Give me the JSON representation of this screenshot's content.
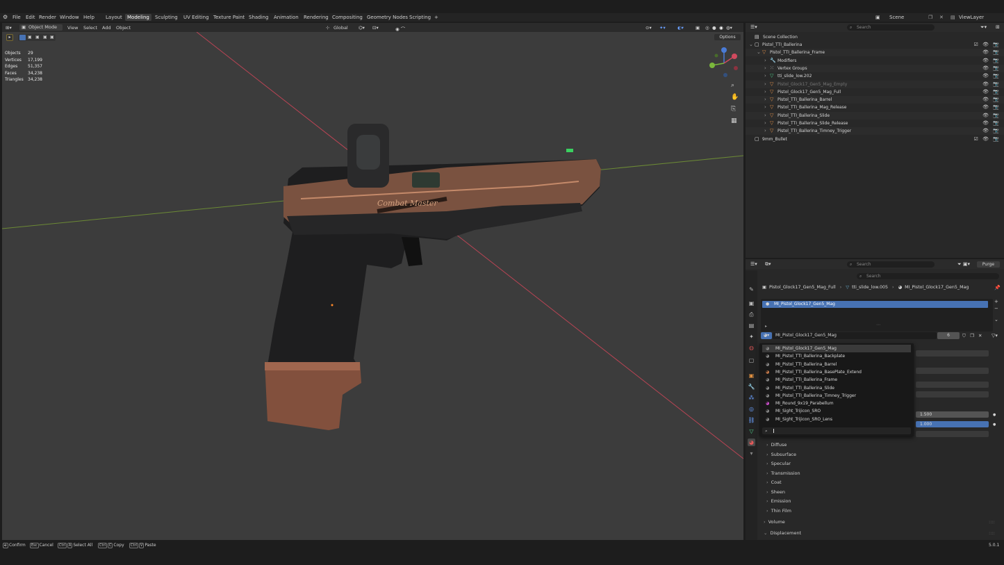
{
  "menus": [
    "File",
    "Edit",
    "Render",
    "Window",
    "Help"
  ],
  "workspaces": [
    "Layout",
    "Modeling",
    "Sculpting",
    "UV Editing",
    "Texture Paint",
    "Shading",
    "Animation",
    "Rendering",
    "Compositing",
    "Geometry Nodes",
    "Scripting"
  ],
  "scene_label": "Scene",
  "viewlayer_label": "ViewLayer",
  "viewport_header": {
    "mode": "Object Mode",
    "menus": [
      "View",
      "Select",
      "Add",
      "Object"
    ],
    "orientation": "Global",
    "options": "Options"
  },
  "stats": [
    {
      "label": "Objects",
      "value": "29"
    },
    {
      "label": "Vertices",
      "value": "17,199"
    },
    {
      "label": "Edges",
      "value": "51,357"
    },
    {
      "label": "Faces",
      "value": "34,238"
    },
    {
      "label": "Triangles",
      "value": "34,238"
    }
  ],
  "gun_text": "Combat Master",
  "outliner": {
    "search_placeholder": "Search",
    "root": "Scene Collection",
    "rows": [
      {
        "label": "Pistol_TTI_Ballerina",
        "indent": 0
      },
      {
        "label": "Pistol_TTI_Ballerina_Frame",
        "indent": 1
      },
      {
        "label": "Modifiers",
        "indent": 2
      },
      {
        "label": "Vertex Groups",
        "indent": 2
      },
      {
        "label": "tti_slide_low.202",
        "indent": 2
      },
      {
        "label": "Pistol_Glock17_Gen5_Mag_Empty",
        "indent": 2,
        "dim": true
      },
      {
        "label": "Pistol_Glock17_Gen5_Mag_Full",
        "indent": 2
      },
      {
        "label": "Pistol_TTI_Ballerina_Barrel",
        "indent": 2
      },
      {
        "label": "Pistol_TTI_Ballerina_Mag_Release",
        "indent": 2
      },
      {
        "label": "Pistol_TTI_Ballerina_Slide",
        "indent": 2
      },
      {
        "label": "Pistol_TTI_Ballerina_Slide_Release",
        "indent": 2
      },
      {
        "label": "Pistol_TTI_Ballerina_Timney_Trigger",
        "indent": 2
      },
      {
        "label": "9mm_Bullet",
        "indent": 0
      }
    ]
  },
  "properties": {
    "search_placeholder": "Search",
    "purge_label": "Purge",
    "breadcrumb": [
      "Pistol_Glock17_Gen5_Mag_Full",
      "tti_slide_low.005",
      "MI_Pistol_Glock17_Gen5_Mag"
    ],
    "slot_selected": "MI_Pistol_Glock17_Gen5_Mag",
    "material_field": "MI_Pistol_Glock17_Gen5_Mag",
    "user_count": "6",
    "value_1": "1.500",
    "value_2": "1.000",
    "sections": [
      "Diffuse",
      "Subsurface",
      "Specular",
      "Transmission",
      "Coat",
      "Sheen",
      "Emission",
      "Thin Film"
    ],
    "sections_outer": [
      "Volume",
      "Displacement"
    ]
  },
  "dropdown": {
    "items": [
      "MI_Pistol_Glock17_Gen5_Mag",
      "MI_Pistol_TTI_Ballerina_Backplate",
      "MI_Pistol_TTI_Ballerina_Barrel",
      "MI_Pistol_TTI_Ballerina_BasePlate_Extend",
      "MI_Pistol_TTI_Ballerina_Frame",
      "MI_Pistol_TTI_Ballerina_Slide",
      "MI_Pistol_TTI_Ballerina_Timney_Trigger",
      "MI_Round_9x19_Parabellum",
      "MI_Sight_Trijicon_SRO",
      "MI_Sight_Trijicon_SRO_Lens"
    ]
  },
  "statusbar": {
    "confirm": "Confirm",
    "cancel": "Cancel",
    "select_all": "Select All",
    "copy": "Copy",
    "paste": "Paste",
    "version": "5.0.1",
    "k_esc": "Esc",
    "k_ctrl": "Ctrl",
    "k_a": "A",
    "k_c": "C",
    "k_v": "V"
  }
}
